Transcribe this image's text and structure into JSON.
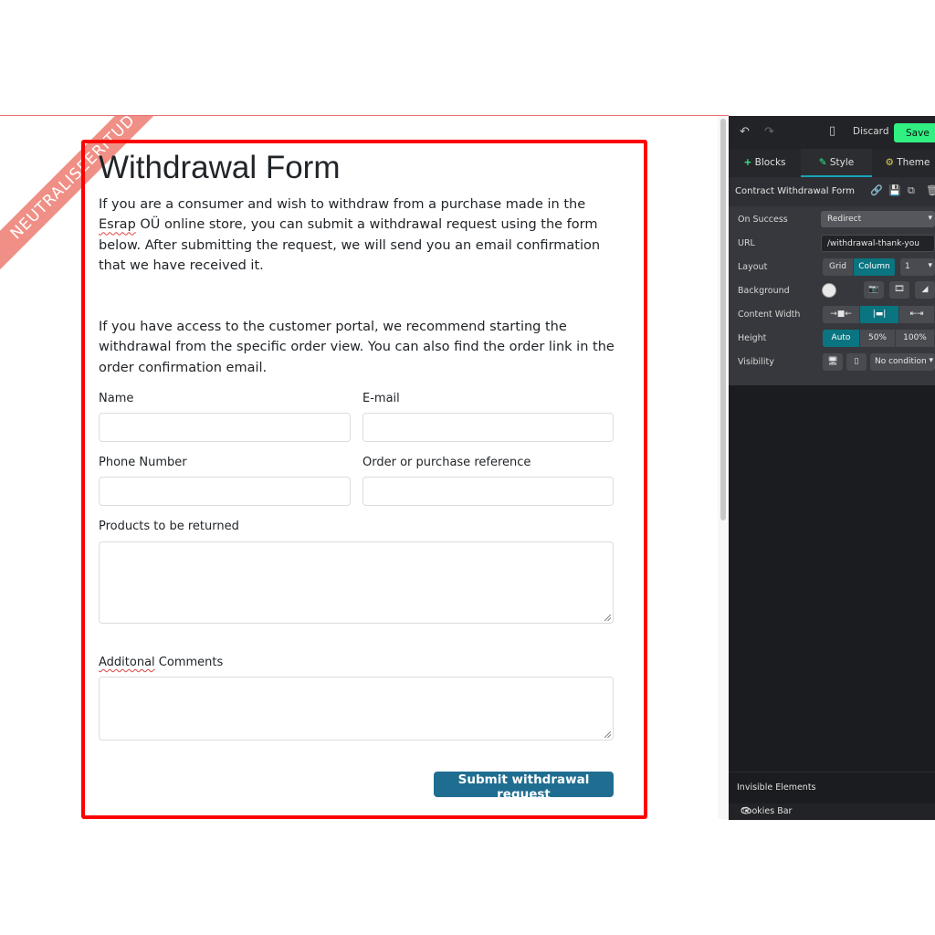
{
  "ribbon": "NEUTRALISEERITUD",
  "form": {
    "title": "Withdrawal Form",
    "intro_a": "If you are a consumer and wish to withdraw from a purchase made in the ",
    "intro_brand": "Esrap",
    "intro_b": " OÜ online store, you can submit a withdrawal request using the form below. After submitting the request, we will send you an email confirmation that we have received it.",
    "intro2": "If you have access to the customer portal, we recommend starting the withdrawal from the specific order view. You can also find the order link in the order confirmation email.",
    "name_label": "Name",
    "email_label": "E-mail",
    "phone_label": "Phone Number",
    "order_label": "Order or purchase reference",
    "products_label": "Products to be returned",
    "comments_label_a": "Additonal",
    "comments_label_b": " Comments",
    "submit_label": "Submit withdrawal request"
  },
  "editor": {
    "discard_label": "Discard",
    "save_label": "Save",
    "tabs": [
      {
        "label": "Blocks",
        "icon": "plus-icon"
      },
      {
        "label": "Style",
        "icon": "pencil-icon"
      },
      {
        "label": "Theme",
        "icon": "gear-icon"
      }
    ],
    "section_title": "Contract Withdrawal Form",
    "options": {
      "on_success_label": "On Success",
      "on_success_value": "Redirect",
      "url_label": "URL",
      "url_value": "/withdrawal-thank-you",
      "layout_label": "Layout",
      "layout_grid": "Grid",
      "layout_column": "Column",
      "layout_count": "1",
      "background_label": "Background",
      "content_width_label": "Content Width",
      "height_label": "Height",
      "height_auto": "Auto",
      "height_50": "50%",
      "height_100": "100%",
      "visibility_label": "Visibility",
      "visibility_value": "No condition"
    },
    "invisible_elements_title": "Invisible Elements",
    "cookies_bar_label": "Cookies Bar"
  },
  "colors": {
    "frame": "#ff0000",
    "submit": "#1f6e91",
    "save": "#30f082",
    "panel": "#1b1c20",
    "active_segment": "#0a7480"
  }
}
